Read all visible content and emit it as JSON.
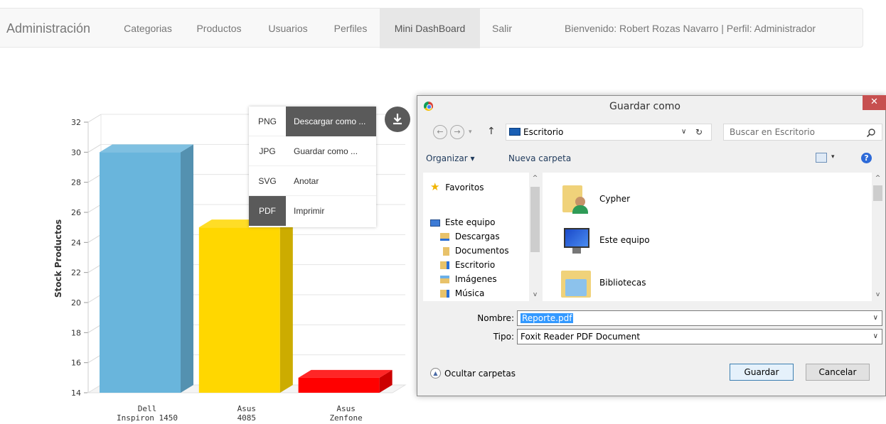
{
  "navbar": {
    "brand": "Administración",
    "items": [
      {
        "label": "Categorias"
      },
      {
        "label": "Productos"
      },
      {
        "label": "Usuarios"
      },
      {
        "label": "Perfiles"
      },
      {
        "label": "Mini DashBoard",
        "active": true
      },
      {
        "label": "Salir"
      }
    ],
    "welcome": "Bienvenido: Robert Rozas Navarro | Perfil: Administrador"
  },
  "chart_data": {
    "type": "bar",
    "style": "3d",
    "categories": [
      [
        "Dell",
        "Inspiron 1450"
      ],
      [
        "Asus",
        "4085"
      ],
      [
        "Asus",
        "Zenfone"
      ]
    ],
    "values": [
      30,
      25,
      15
    ],
    "colors": [
      "#69b5dc",
      "#ffd700",
      "#ff0000"
    ],
    "ylabel": "Stock Productos",
    "xlabel": "",
    "ylim": [
      14,
      32
    ],
    "yticks": [
      "14",
      "16",
      "18",
      "20",
      "22",
      "24",
      "26",
      "28",
      "30",
      "32"
    ],
    "grid": true
  },
  "export_menu": {
    "rows": [
      {
        "format": "PNG",
        "action": "Descargar como ...",
        "dark_format": false,
        "dark_action": true
      },
      {
        "format": "JPG",
        "action": "Guardar como ...",
        "dark_format": false,
        "dark_action": false
      },
      {
        "format": "SVG",
        "action": "Anotar",
        "dark_format": false,
        "dark_action": false
      },
      {
        "format": "PDF",
        "action": "Imprimir",
        "dark_format": true,
        "dark_action": false
      }
    ]
  },
  "dialog": {
    "title": "Guardar como",
    "close_label": "✕",
    "address": "Escritorio",
    "search_placeholder": "Buscar en Escritorio",
    "toolbar": {
      "organize": "Organizar ▾",
      "new_folder": "Nueva carpeta"
    },
    "tree": [
      {
        "label": "Favoritos",
        "icon": "star-icon"
      },
      {
        "label": "Este equipo",
        "icon": "computer-icon"
      },
      {
        "label": "Descargas",
        "icon": "downloads-folder-icon"
      },
      {
        "label": "Documentos",
        "icon": "documents-folder-icon"
      },
      {
        "label": "Escritorio",
        "icon": "desktop-folder-icon"
      },
      {
        "label": "Imágenes",
        "icon": "pictures-folder-icon"
      },
      {
        "label": "Música",
        "icon": "music-folder-icon"
      }
    ],
    "files": [
      {
        "label": "Cypher",
        "icon": "user-folder-icon"
      },
      {
        "label": "Este equipo",
        "icon": "computer-icon"
      },
      {
        "label": "Bibliotecas",
        "icon": "libraries-folder-icon"
      }
    ],
    "name_label": "Nombre:",
    "name_value": "Reporte.pdf",
    "type_label": "Tipo:",
    "type_value": "Foxit Reader PDF Document",
    "hide_folders": "Ocultar carpetas",
    "save_button": "Guardar",
    "cancel_button": "Cancelar"
  }
}
